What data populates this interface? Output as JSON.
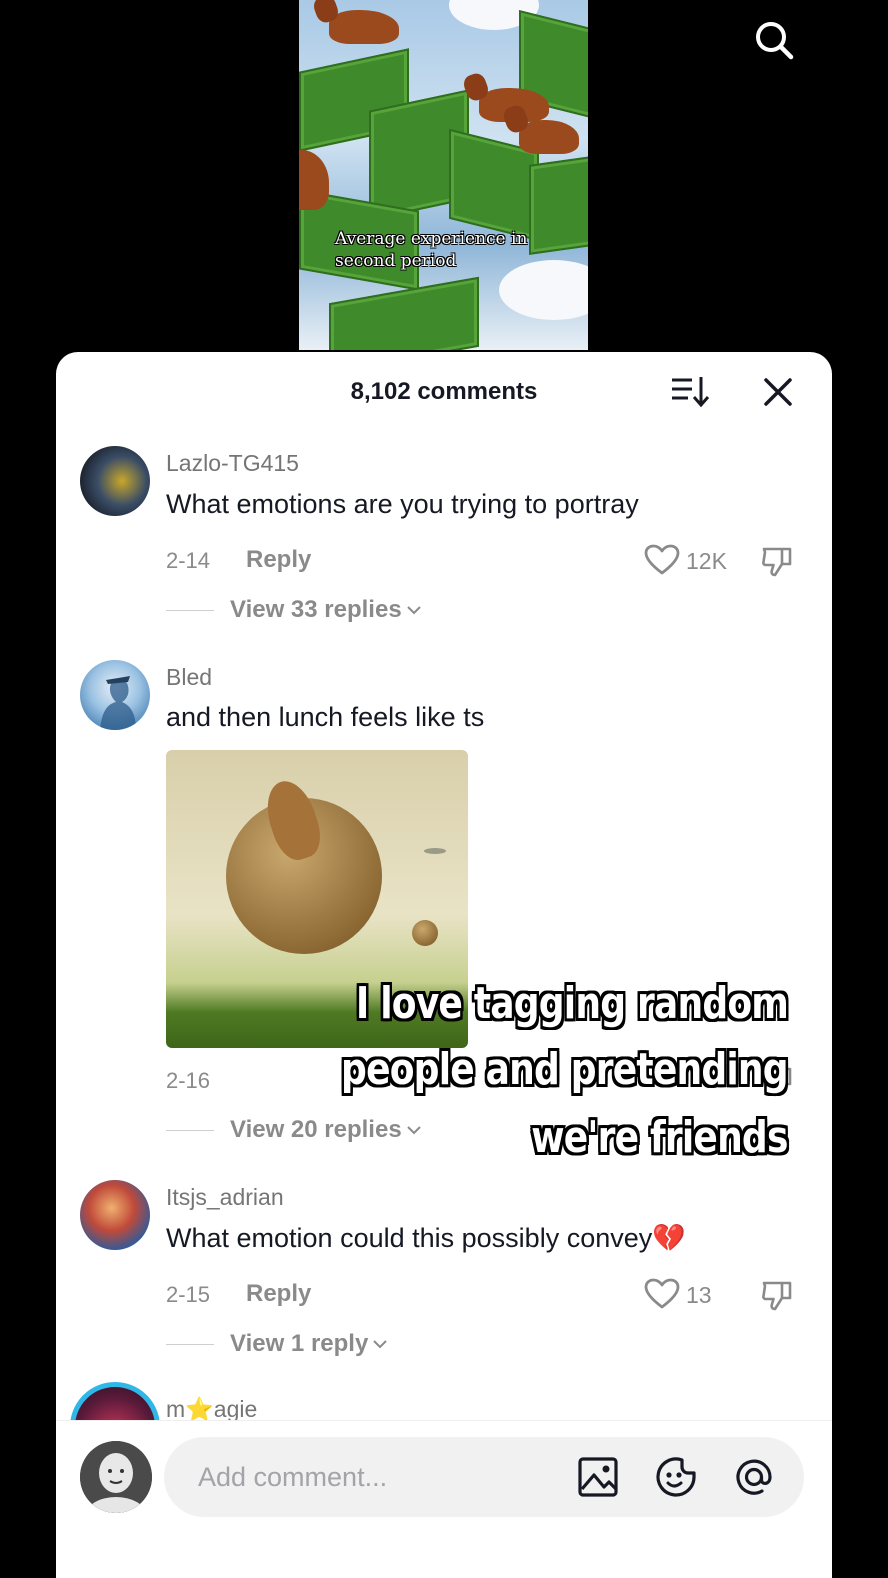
{
  "video": {
    "caption_line1": "Average experience in",
    "caption_line2": "second period"
  },
  "overlay": {
    "line1": "I love tagging random",
    "line2": "people and pretending",
    "line3": "we're friends"
  },
  "comments_panel": {
    "title": "8,102 comments",
    "comments": [
      {
        "username": "Lazlo-TG415",
        "text": "What emotions are you trying to portray",
        "date": "2-14",
        "reply_label": "Reply",
        "likes": "12K",
        "view_replies": "View 33 replies"
      },
      {
        "username": "Bled",
        "text": "and then lunch feels like ts",
        "date": "2-16",
        "view_replies": "View 20 replies"
      },
      {
        "username": "Itsjs_adrian",
        "text": "What emotion could this possibly convey💔",
        "date": "2-15",
        "reply_label": "Reply",
        "likes": "13",
        "view_replies": "View 1 reply"
      },
      {
        "username": "m⭐agie"
      }
    ]
  },
  "composer": {
    "placeholder": "Add comment..."
  },
  "icons": {
    "search": "search-icon",
    "sort": "sort-icon",
    "close": "close-icon",
    "like": "heart-outline-icon",
    "dislike": "thumbs-down-icon",
    "image": "image-icon",
    "emoji": "emoji-icon",
    "mention": "at-mention-icon"
  }
}
